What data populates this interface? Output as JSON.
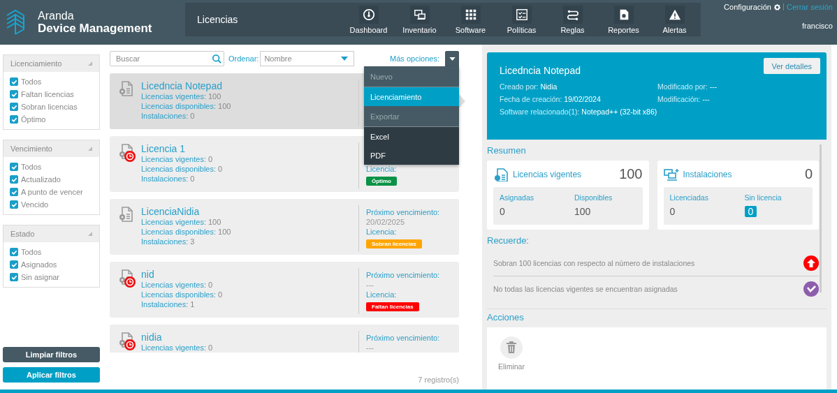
{
  "header": {
    "brand_top": "Aranda",
    "brand_bottom": "Device Management",
    "section_title": "Licencias",
    "nav": [
      {
        "kind": "gauge",
        "label": "Dashboard",
        "selected": false
      },
      {
        "kind": "monitor",
        "label": "Inventario",
        "selected": false
      },
      {
        "kind": "grid",
        "label": "Software",
        "selected": false
      },
      {
        "kind": "checklist",
        "label": "Políticas",
        "selected": false
      },
      {
        "kind": "flow",
        "label": "Reglas",
        "selected": false
      },
      {
        "kind": "report",
        "label": "Reportes",
        "selected": false
      },
      {
        "kind": "warning",
        "label": "Alertas",
        "selected": false
      }
    ],
    "settings_link": "Configuración",
    "logout_link": "Cerrar sesión",
    "user": "francisco"
  },
  "filters": [
    {
      "title": "Licenciamiento",
      "expanded": true,
      "options": [
        {
          "label": "Todos",
          "checked": true
        },
        {
          "label": "Faltan licencias",
          "checked": true
        },
        {
          "label": "Sobran licencias",
          "checked": true
        },
        {
          "label": "Óptimo",
          "checked": true
        }
      ]
    },
    {
      "title": "Vencimiento",
      "expanded": true,
      "options": [
        {
          "label": "Todos",
          "checked": true
        },
        {
          "label": "Actualizado",
          "checked": true
        },
        {
          "label": "A punto de vencer",
          "checked": true
        },
        {
          "label": "Vencido",
          "checked": true
        }
      ]
    },
    {
      "title": "Estado",
      "expanded": true,
      "options": [
        {
          "label": "Todos",
          "checked": true
        },
        {
          "label": "Asignados",
          "checked": true
        },
        {
          "label": "Sin asignar",
          "checked": true
        }
      ]
    }
  ],
  "filter_buttons": {
    "clear": "Limpiar filtros",
    "apply": "Aplicar filtros"
  },
  "toolbar": {
    "search": {
      "placeholder": "Buscar"
    },
    "sort_label": "Ordenar:",
    "sort_value": "Nombre",
    "more_label": "Más opciones:"
  },
  "menu": [
    {
      "kind": "header",
      "text": "Nuevo",
      "selected": false
    },
    {
      "kind": "option",
      "text": "Licenciamiento",
      "selected": true
    },
    {
      "kind": "header",
      "text": "Exportar",
      "selected": false
    },
    {
      "kind": "option",
      "text": "Excel",
      "selected": false
    },
    {
      "kind": "option",
      "text": "PDF",
      "selected": false
    }
  ],
  "licenses": [
    {
      "name": "Licedncia Notepad",
      "selected": true,
      "overdue": false,
      "stats": [
        {
          "label": "Licencias vigentes:",
          "value": "100"
        },
        {
          "label": "Licencias disponibles:",
          "value": "100"
        },
        {
          "label": "Instalaciones:",
          "value": "0"
        }
      ]
    },
    {
      "name": "Licencia 1",
      "selected": false,
      "overdue": true,
      "stats": [
        {
          "label": "Licencias vigentes:",
          "value": "0"
        },
        {
          "label": "Licencias disponibles:",
          "value": "0"
        },
        {
          "label": "Instalaciones:",
          "value": "0"
        }
      ],
      "license_label": "Licencia:",
      "status": {
        "text": "Óptimo",
        "color": "#0a9246"
      }
    },
    {
      "name": "LicenciaNidia",
      "selected": false,
      "overdue": false,
      "stats": [
        {
          "label": "Licencias vigentes:",
          "value": "100"
        },
        {
          "label": "Licencias disponibles:",
          "value": "100"
        },
        {
          "label": "Instalaciones:",
          "value": "3"
        }
      ],
      "expiry_label": "Próximo vencimiento:",
      "expiry": "20/02/2025",
      "license_label": "Licencia:",
      "status": {
        "text": "Sobran licencias",
        "color": "#ffa500"
      }
    },
    {
      "name": "nid",
      "selected": false,
      "overdue": true,
      "stats": [
        {
          "label": "Licencias vigentes:",
          "value": "0"
        },
        {
          "label": "Licencias disponibles:",
          "value": "0"
        },
        {
          "label": "Instalaciones:",
          "value": "1"
        }
      ],
      "expiry_label": "Próximo vencimiento:",
      "expiry": "---",
      "license_label": "Licencia:",
      "status": {
        "text": "Faltan licencias",
        "color": "#ff0000"
      }
    },
    {
      "name": "nidia",
      "selected": false,
      "overdue": true,
      "stats": [
        {
          "label": "Licencias vigentes:",
          "value": "0"
        }
      ],
      "expiry_label": "Próximo vencimiento:",
      "expiry": "---"
    }
  ],
  "record_count": "7 registro(s)",
  "detail": {
    "title": "Licedncia Notepad",
    "details_button": "Ver detalles",
    "fields": [
      {
        "label": "Creado por:",
        "value": "Nidia"
      },
      {
        "label": "Modificado por:",
        "value": "---"
      },
      {
        "label": "Fecha de creación:",
        "value": "19/02/2024"
      },
      {
        "label": "Modificación:",
        "value": "---"
      },
      {
        "label": "Software relacionado(1):",
        "value": "Notepad++ (32-bit x86)"
      }
    ],
    "summary_title": "Resumen",
    "summary": [
      {
        "kind": "license",
        "title": "Licencias vigentes",
        "total": "100",
        "stats": [
          {
            "label": "Asignadas",
            "value": "0",
            "highlighted": false
          },
          {
            "label": "Disponibles",
            "value": "100",
            "highlighted": false
          }
        ]
      },
      {
        "kind": "install",
        "title": "Instalaciones",
        "total": "0",
        "stats": [
          {
            "label": "Licenciadas",
            "value": "0",
            "highlighted": false
          },
          {
            "label": "Sin licencia",
            "value": "0",
            "highlighted": true
          }
        ]
      }
    ],
    "reminder_title": "Recuerde:",
    "reminders": [
      {
        "text": "Sobran 100 licencias con respecto al número de instalaciones",
        "kind": "up",
        "color": "#ff0000"
      },
      {
        "text": "No todas las licencias vigentes se encuentran asignadas",
        "kind": "check",
        "color": "#8e5ead"
      }
    ],
    "actions_title": "Acciones",
    "actions": [
      {
        "kind": "trash",
        "label": "Eliminar"
      }
    ]
  }
}
